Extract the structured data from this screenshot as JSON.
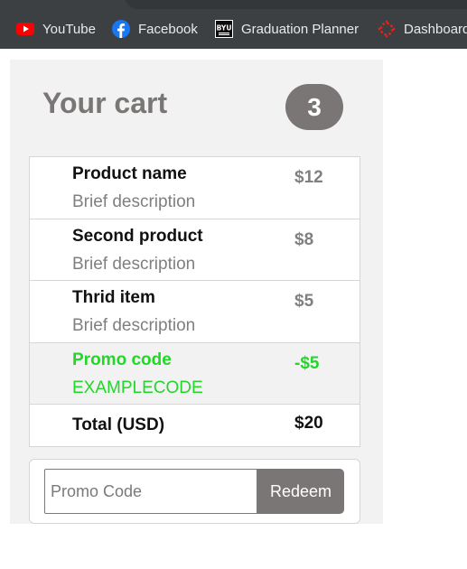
{
  "bookmarks": [
    {
      "label": "YouTube",
      "icon": "youtube-icon"
    },
    {
      "label": "Facebook",
      "icon": "facebook-icon"
    },
    {
      "label": "Graduation Planner",
      "icon": "byu-icon",
      "icon_text": "BYU"
    },
    {
      "label": "Dashboard",
      "icon": "dashboard-icon"
    }
  ],
  "cart": {
    "title": "Your cart",
    "count": "3",
    "items": [
      {
        "name": "Product name",
        "description": "Brief description",
        "price": "$12"
      },
      {
        "name": "Second product",
        "description": "Brief description",
        "price": "$8"
      },
      {
        "name": "Thrid item",
        "description": "Brief description",
        "price": "$5"
      }
    ],
    "promo": {
      "label": "Promo code",
      "code": "EXAMPLECODE",
      "amount": "-$5"
    },
    "total": {
      "label": "Total (USD)",
      "amount": "$20"
    }
  },
  "redeem": {
    "placeholder": "Promo Code",
    "value": "",
    "button_label": "Redeem"
  },
  "colors": {
    "accent_gray": "#7a7676",
    "promo_green": "#23d62a",
    "panel_bg": "#f3f2f2",
    "bookmarks_bg": "#3c4043"
  }
}
